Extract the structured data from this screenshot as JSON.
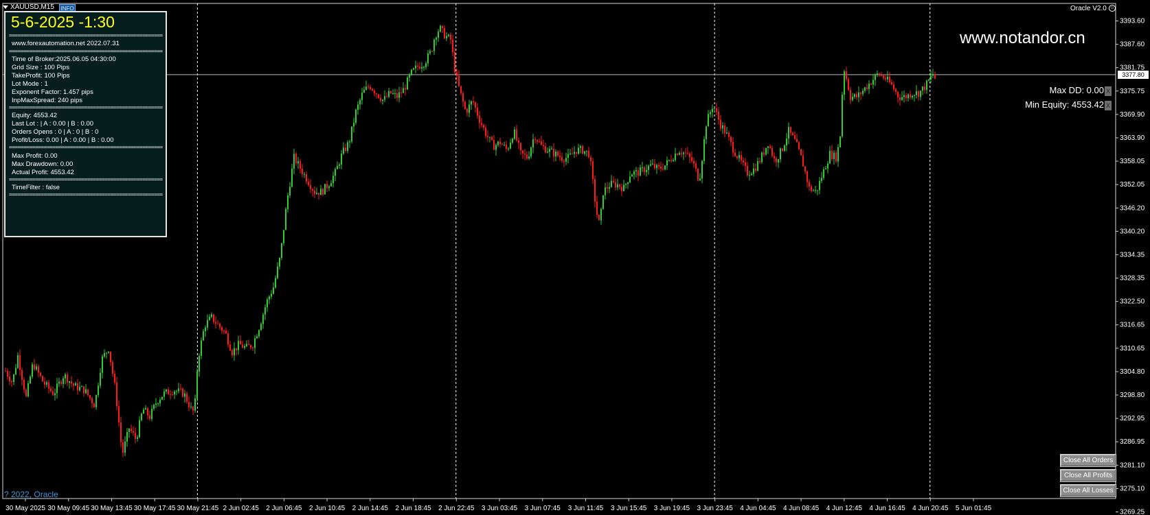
{
  "window": {
    "symbol": "XAUUSD,M15",
    "info_badge": "INFO",
    "ea_name": "Oracle V2.0"
  },
  "watermark": "www.notandor.cn",
  "panel": {
    "datetime": "5-6-2025 -1:30",
    "separator": "=====================================================",
    "site": "www.forexautomation.net 2022.07.31",
    "time_of_broker": "Time of Broker:2025.06.05 04:30:00",
    "grid_size": "Grid Size : 100 Pips",
    "take_profit": "TakeProfit: 100 Pips",
    "lot_mode": "Lot Mode : 1",
    "exponent_factor": "Exponent Factor: 1.457 pips",
    "max_spread": "InpMaxSpread: 240 pips",
    "equity": "Equity:      4553.42",
    "last_lot": "Last Lot :   | A : 0.00  | B : 0.00",
    "orders_opens": "Orders Opens :    0  | A : 0  | B : 0",
    "profit_loss": "Profit/Loss: 0.00  | A : 0.00  | B : 0.00",
    "max_profit": "Max Profit: 0.00",
    "max_drawdown": "Max Drawdown: 0.00",
    "actual_profit": "Actual Profit: 4553.42",
    "time_filter": "TimeFilter : false"
  },
  "stats": {
    "max_dd": "Max DD: 0.00",
    "min_equity": "Min Equity: 4553.42",
    "close_glyph": "X"
  },
  "copyright": "? 2022, Oracle",
  "buttons": {
    "close_all_orders": "Close All Orders",
    "close_all_profits": "Close All Profits",
    "close_all_losses": "Close All Losses"
  },
  "colors": {
    "background": "#000000",
    "bull": "#32cd32",
    "bear": "#ff1a1a",
    "panel_bg": "#061e1e",
    "panel_title": "#ffff1a",
    "copyright": "#3a9ad9"
  },
  "chart_data": {
    "type": "candlestick",
    "current_price": 3377.8,
    "price_labels": [
      "3393.60",
      "3387.60",
      "3381.75",
      "3375.75",
      "3369.90",
      "3363.90",
      "3358.05",
      "3352.05",
      "3346.20",
      "3340.20",
      "3334.35",
      "3328.35",
      "3322.50",
      "3316.65",
      "3310.65",
      "3304.80",
      "3298.80",
      "3292.95",
      "3286.95",
      "3281.10",
      "3275.10",
      "3269.25"
    ],
    "time_labels": [
      "30 May 2025",
      "30 May 09:45",
      "30 May 13:45",
      "30 May 17:45",
      "30 May 21:45",
      "2 Jun 02:45",
      "2 Jun 06:45",
      "2 Jun 10:45",
      "2 Jun 14:45",
      "2 Jun 18:45",
      "2 Jun 22:45",
      "3 Jun 03:45",
      "3 Jun 07:45",
      "3 Jun 11:45",
      "3 Jun 15:45",
      "3 Jun 19:45",
      "3 Jun 23:45",
      "4 Jun 04:45",
      "4 Jun 08:45",
      "4 Jun 12:45",
      "4 Jun 16:45",
      "4 Jun 20:45",
      "5 Jun 01:45"
    ],
    "day_separators": [
      "30 May 21:45",
      "2 Jun 22:45",
      "3 Jun 23:45",
      "4 Jun 20:45"
    ],
    "ylim": [
      3266.5,
      3396.5
    ],
    "path": [
      [
        0,
        3300
      ],
      [
        10,
        3297
      ],
      [
        18,
        3304
      ],
      [
        30,
        3293
      ],
      [
        40,
        3302
      ],
      [
        55,
        3297
      ],
      [
        70,
        3294
      ],
      [
        85,
        3299
      ],
      [
        100,
        3296
      ],
      [
        115,
        3295
      ],
      [
        130,
        3291
      ],
      [
        140,
        3303
      ],
      [
        150,
        3306
      ],
      [
        160,
        3295
      ],
      [
        170,
        3278
      ],
      [
        180,
        3285
      ],
      [
        190,
        3282
      ],
      [
        200,
        3290
      ],
      [
        210,
        3288
      ],
      [
        220,
        3292
      ],
      [
        230,
        3294
      ],
      [
        245,
        3295
      ],
      [
        260,
        3294
      ],
      [
        270,
        3290
      ],
      [
        275,
        3289
      ],
      [
        280,
        3303
      ],
      [
        290,
        3312
      ],
      [
        300,
        3314
      ],
      [
        310,
        3312
      ],
      [
        320,
        3310
      ],
      [
        330,
        3305
      ],
      [
        340,
        3307
      ],
      [
        350,
        3306
      ],
      [
        360,
        3307
      ],
      [
        370,
        3312
      ],
      [
        380,
        3318
      ],
      [
        390,
        3322
      ],
      [
        400,
        3330
      ],
      [
        410,
        3345
      ],
      [
        420,
        3356
      ],
      [
        430,
        3353
      ],
      [
        440,
        3350
      ],
      [
        450,
        3347
      ],
      [
        460,
        3347
      ],
      [
        470,
        3349
      ],
      [
        480,
        3352
      ],
      [
        490,
        3357
      ],
      [
        500,
        3360
      ],
      [
        510,
        3368
      ],
      [
        520,
        3373
      ],
      [
        530,
        3375
      ],
      [
        540,
        3373
      ],
      [
        550,
        3371
      ],
      [
        560,
        3373
      ],
      [
        570,
        3372
      ],
      [
        580,
        3374
      ],
      [
        590,
        3378
      ],
      [
        600,
        3380
      ],
      [
        610,
        3381
      ],
      [
        620,
        3384
      ],
      [
        625,
        3388
      ],
      [
        632,
        3390
      ],
      [
        640,
        3388
      ],
      [
        648,
        3387
      ],
      [
        655,
        3378
      ],
      [
        662,
        3373
      ],
      [
        670,
        3368
      ],
      [
        680,
        3371
      ],
      [
        690,
        3366
      ],
      [
        700,
        3362
      ],
      [
        710,
        3359
      ],
      [
        720,
        3360
      ],
      [
        730,
        3358
      ],
      [
        740,
        3363
      ],
      [
        750,
        3357
      ],
      [
        760,
        3356
      ],
      [
        770,
        3362
      ],
      [
        780,
        3359
      ],
      [
        790,
        3358
      ],
      [
        800,
        3357
      ],
      [
        810,
        3356
      ],
      [
        820,
        3356
      ],
      [
        830,
        3358
      ],
      [
        840,
        3358
      ],
      [
        850,
        3357
      ],
      [
        860,
        3342
      ],
      [
        865,
        3338
      ],
      [
        870,
        3347
      ],
      [
        880,
        3349
      ],
      [
        890,
        3349
      ],
      [
        900,
        3348
      ],
      [
        910,
        3352
      ],
      [
        920,
        3352
      ],
      [
        930,
        3353
      ],
      [
        940,
        3354
      ],
      [
        950,
        3353
      ],
      [
        960,
        3354
      ],
      [
        970,
        3356
      ],
      [
        980,
        3358
      ],
      [
        990,
        3357
      ],
      [
        1000,
        3355
      ],
      [
        1010,
        3350
      ],
      [
        1020,
        3365
      ],
      [
        1030,
        3370
      ],
      [
        1040,
        3365
      ],
      [
        1050,
        3362
      ],
      [
        1060,
        3358
      ],
      [
        1070,
        3355
      ],
      [
        1080,
        3352
      ],
      [
        1090,
        3353
      ],
      [
        1100,
        3356
      ],
      [
        1110,
        3360
      ],
      [
        1120,
        3355
      ],
      [
        1130,
        3358
      ],
      [
        1140,
        3363
      ],
      [
        1150,
        3360
      ],
      [
        1160,
        3355
      ],
      [
        1170,
        3348
      ],
      [
        1180,
        3347
      ],
      [
        1190,
        3352
      ],
      [
        1200,
        3357
      ],
      [
        1210,
        3356
      ],
      [
        1215,
        3362
      ],
      [
        1220,
        3380
      ],
      [
        1230,
        3372
      ],
      [
        1240,
        3372
      ],
      [
        1250,
        3374
      ],
      [
        1260,
        3376
      ],
      [
        1270,
        3378
      ],
      [
        1280,
        3377
      ],
      [
        1290,
        3375
      ],
      [
        1300,
        3372
      ],
      [
        1310,
        3372
      ],
      [
        1320,
        3373
      ],
      [
        1330,
        3373
      ],
      [
        1340,
        3375
      ],
      [
        1350,
        3378
      ],
      [
        1355,
        3376
      ],
      [
        1365,
        3377
      ]
    ]
  }
}
